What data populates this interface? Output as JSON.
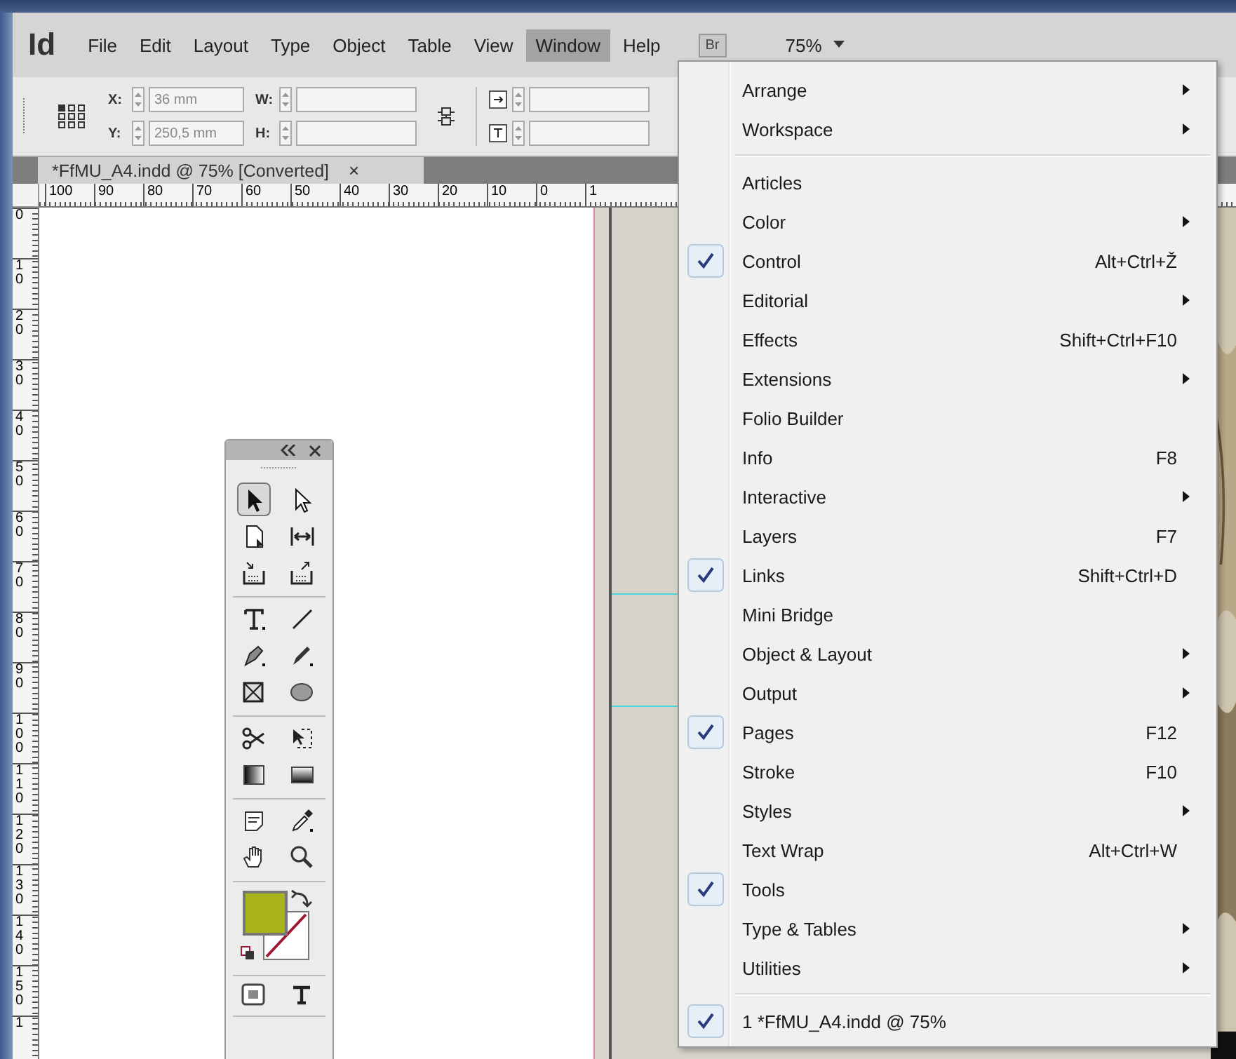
{
  "menubar": {
    "logo": "Id",
    "items": [
      {
        "label": "File",
        "selected": false
      },
      {
        "label": "Edit",
        "selected": false
      },
      {
        "label": "Layout",
        "selected": false
      },
      {
        "label": "Type",
        "selected": false
      },
      {
        "label": "Object",
        "selected": false
      },
      {
        "label": "Table",
        "selected": false
      },
      {
        "label": "View",
        "selected": false
      },
      {
        "label": "Window",
        "selected": true
      },
      {
        "label": "Help",
        "selected": false
      }
    ],
    "bridge": "Br",
    "zoom": "75%"
  },
  "control_panel": {
    "position_fields": [
      {
        "label": "X:",
        "value": "36 mm"
      },
      {
        "label": "Y:",
        "value": "250,5 mm"
      }
    ],
    "size_fields": [
      {
        "label": "W:"
      },
      {
        "label": "H:"
      }
    ]
  },
  "document_tab": {
    "title": "*FfMU_A4.indd @ 75% [Converted]",
    "close": "×"
  },
  "ruler": {
    "horizontal": [
      "100",
      "90",
      "80",
      "70",
      "60",
      "50",
      "40",
      "30",
      "20",
      "10",
      "0",
      "1"
    ],
    "vertical": [
      "0",
      "10",
      "20",
      "30",
      "40",
      "50",
      "60",
      "70",
      "80",
      "90",
      "100",
      "110",
      "120",
      "130",
      "140",
      "150",
      "1"
    ]
  },
  "tool_groups": [
    [
      {
        "kind": "selection",
        "selected": true
      },
      {
        "kind": "direct-selection",
        "selected": false
      },
      {
        "kind": "page",
        "selected": false
      },
      {
        "kind": "gap",
        "selected": false
      },
      {
        "kind": "content-collector",
        "selected": false
      },
      {
        "kind": "content-placer",
        "selected": false
      }
    ],
    [
      {
        "kind": "type",
        "selected": false
      },
      {
        "kind": "line",
        "selected": false
      },
      {
        "kind": "pen",
        "selected": false
      },
      {
        "kind": "pencil",
        "selected": false
      },
      {
        "kind": "rectangle-frame",
        "selected": false
      },
      {
        "kind": "ellipse",
        "selected": false
      }
    ],
    [
      {
        "kind": "scissors",
        "selected": false
      },
      {
        "kind": "free-transform",
        "selected": false
      },
      {
        "kind": "gradient",
        "selected": false
      },
      {
        "kind": "gradient-feather",
        "selected": false
      }
    ],
    [
      {
        "kind": "note",
        "selected": false
      },
      {
        "kind": "eyedropper",
        "selected": false
      },
      {
        "kind": "hand",
        "selected": false
      },
      {
        "kind": "zoom",
        "selected": false
      }
    ]
  ],
  "window_menu": {
    "sections": [
      [
        {
          "label": "Arrange",
          "kind": "submenu",
          "checked": false
        },
        {
          "label": "Workspace",
          "kind": "submenu",
          "checked": false
        }
      ],
      [
        {
          "label": "Articles",
          "kind": "plain",
          "checked": false
        },
        {
          "label": "Color",
          "kind": "submenu",
          "checked": false
        },
        {
          "label": "Control",
          "kind": "shortcut",
          "shortcut": "Alt+Ctrl+Ž",
          "checked": true
        },
        {
          "label": "Editorial",
          "kind": "submenu",
          "checked": false
        },
        {
          "label": "Effects",
          "kind": "shortcut",
          "shortcut": "Shift+Ctrl+F10",
          "checked": false
        },
        {
          "label": "Extensions",
          "kind": "submenu",
          "checked": false
        },
        {
          "label": "Folio Builder",
          "kind": "plain",
          "checked": false
        },
        {
          "label": "Info",
          "kind": "shortcut",
          "shortcut": "F8",
          "checked": false
        },
        {
          "label": "Interactive",
          "kind": "submenu",
          "checked": false
        },
        {
          "label": "Layers",
          "kind": "shortcut",
          "shortcut": "F7",
          "checked": false
        },
        {
          "label": "Links",
          "kind": "shortcut",
          "shortcut": "Shift+Ctrl+D",
          "checked": true
        },
        {
          "label": "Mini Bridge",
          "kind": "plain",
          "checked": false
        },
        {
          "label": "Object & Layout",
          "kind": "submenu",
          "checked": false
        },
        {
          "label": "Output",
          "kind": "submenu",
          "checked": false
        },
        {
          "label": "Pages",
          "kind": "shortcut",
          "shortcut": "F12",
          "checked": true
        },
        {
          "label": "Stroke",
          "kind": "shortcut",
          "shortcut": "F10",
          "checked": false
        },
        {
          "label": "Styles",
          "kind": "submenu",
          "checked": false
        },
        {
          "label": "Text Wrap",
          "kind": "shortcut",
          "shortcut": "Alt+Ctrl+W",
          "checked": false
        },
        {
          "label": "Tools",
          "kind": "plain",
          "checked": true
        },
        {
          "label": "Type & Tables",
          "kind": "submenu",
          "checked": false
        },
        {
          "label": "Utilities",
          "kind": "submenu",
          "checked": false
        }
      ],
      [
        {
          "label": "1 *FfMU_A4.indd @ 75%",
          "kind": "plain",
          "checked": true
        }
      ]
    ]
  }
}
